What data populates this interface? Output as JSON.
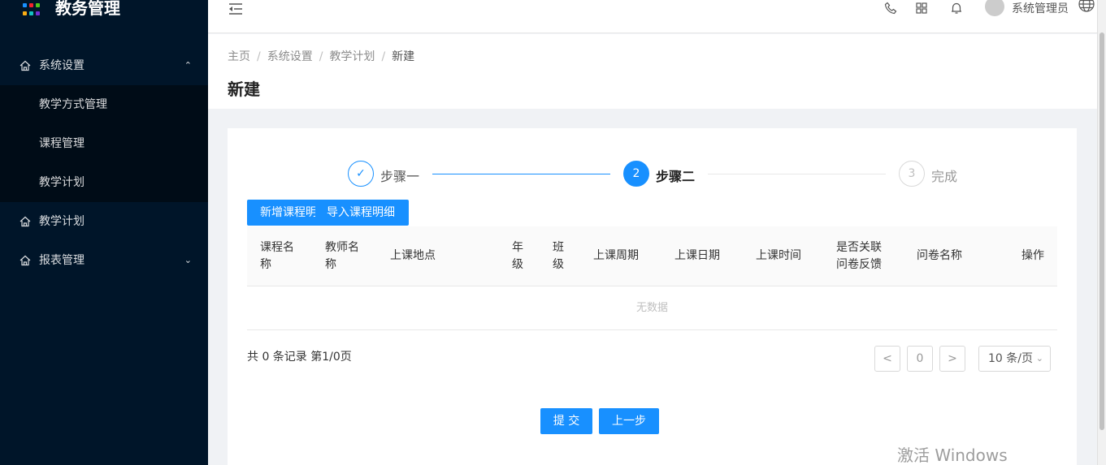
{
  "app": {
    "title": "教务管理",
    "brand_colors": [
      "#1890ff",
      "#f5222d",
      "#52c41a",
      "#faad14",
      "#13c2c2",
      "#722ed1",
      "#1890ff",
      "#fa541c",
      "#2f54eb"
    ]
  },
  "sidebar": {
    "items": [
      {
        "label": "系统设置",
        "icon": "home-icon",
        "expanded": true
      },
      {
        "label": "教学方式管理"
      },
      {
        "label": "课程管理"
      },
      {
        "label": "教学计划"
      },
      {
        "label": "教学计划",
        "icon": "home-icon"
      },
      {
        "label": "报表管理",
        "icon": "home-icon",
        "expanded": false
      }
    ]
  },
  "header": {
    "user_name": "系统管理员",
    "icons": [
      "menu-fold-icon",
      "phone-icon",
      "apps-icon",
      "bell-icon",
      "avatar",
      "globe-icon"
    ]
  },
  "page": {
    "breadcrumb": [
      "主页",
      "系统设置",
      "教学计划",
      "新建"
    ],
    "separator": "/",
    "title": "新建"
  },
  "steps": [
    {
      "num": "✓",
      "label": "步骤一",
      "status": "finished"
    },
    {
      "num": "2",
      "label": "步骤二",
      "status": "active"
    },
    {
      "num": "3",
      "label": "完成",
      "status": "waiting"
    }
  ],
  "actions": {
    "add_course": "新增课程明",
    "import_course": "导入课程明细"
  },
  "table": {
    "columns": [
      {
        "lines": [
          "课程名",
          "称"
        ]
      },
      {
        "lines": [
          "教师名",
          "称"
        ]
      },
      {
        "lines": [
          "上课地点"
        ]
      },
      {
        "lines": [
          "年",
          "级"
        ]
      },
      {
        "lines": [
          "班",
          "级"
        ]
      },
      {
        "lines": [
          "上课周期"
        ]
      },
      {
        "lines": [
          "上课日期"
        ]
      },
      {
        "lines": [
          "上课时间"
        ]
      },
      {
        "lines": [
          "是否关联",
          "问卷反馈"
        ]
      },
      {
        "lines": [
          "问卷名称"
        ]
      },
      {
        "lines": [
          "操作"
        ]
      }
    ],
    "empty_text": "无数据"
  },
  "pagination": {
    "total_text": "共 0 条记录 第1/0页",
    "prev": "<",
    "page": "0",
    "next": ">",
    "page_size": "10 条/页"
  },
  "footer_buttons": {
    "submit": "提 交",
    "prev_step": "上一步"
  },
  "watermark": "激活 Windows"
}
